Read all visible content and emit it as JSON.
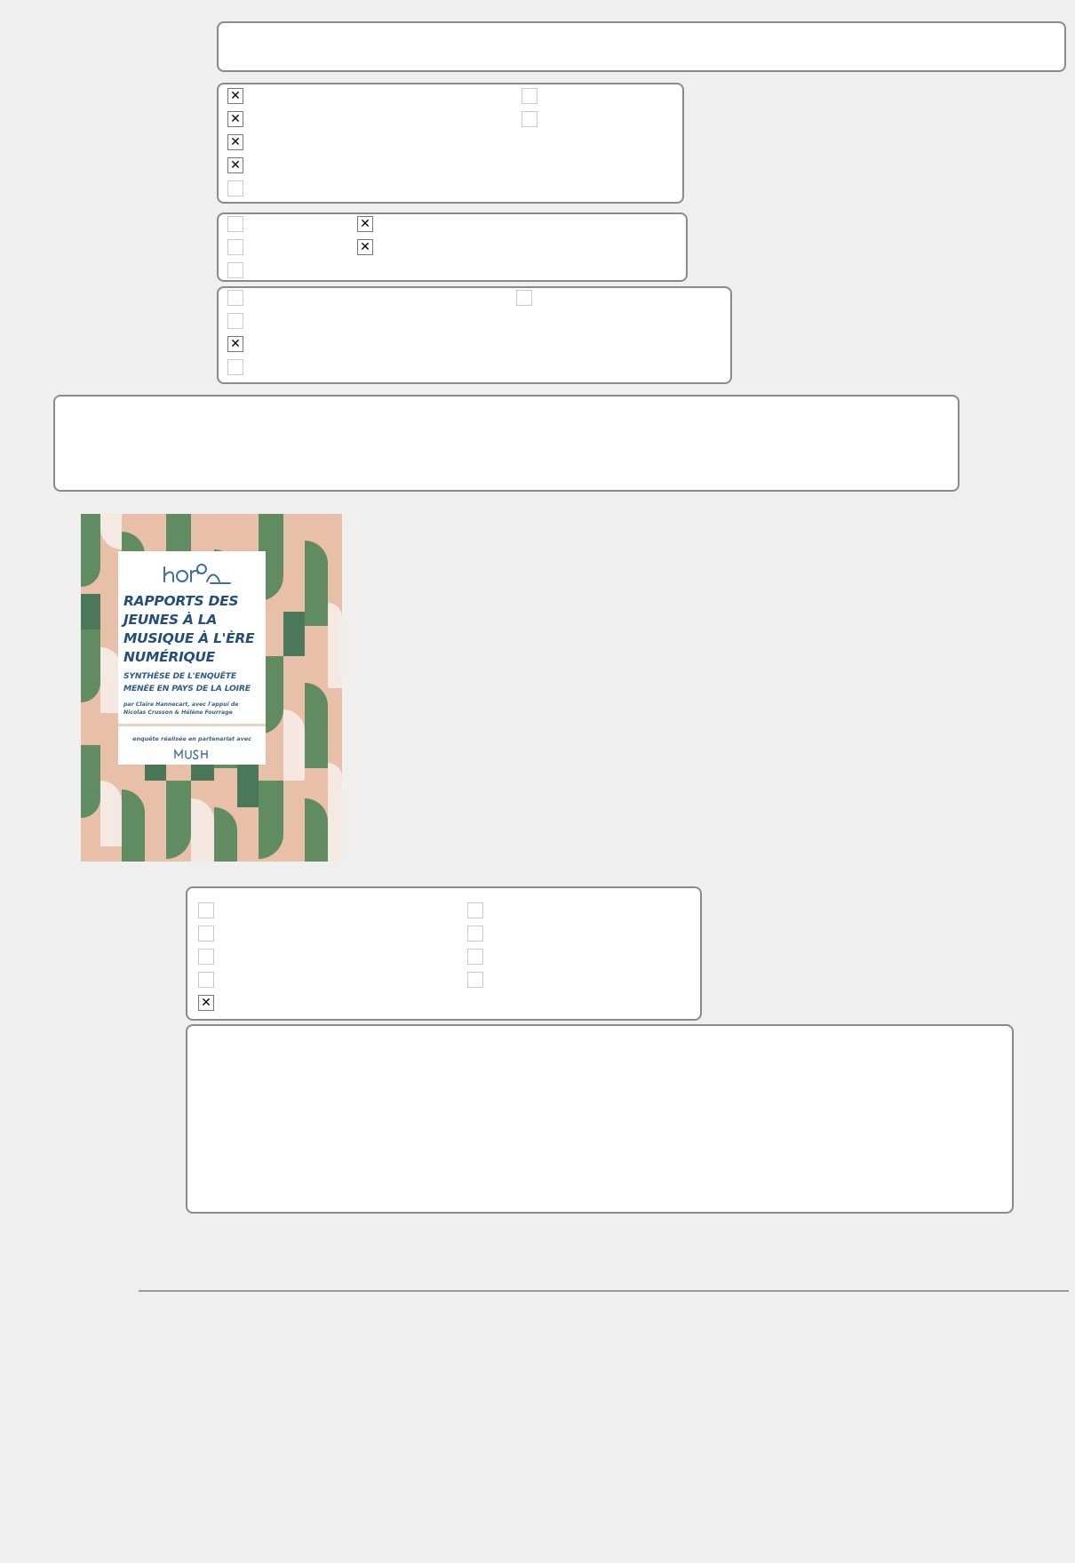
{
  "form": {
    "top_input": {
      "value": ""
    },
    "group_1": {
      "checkboxes": [
        {
          "checked": true
        },
        {
          "checked": true
        },
        {
          "checked": true
        },
        {
          "checked": true
        },
        {
          "checked": false
        },
        {
          "checked": false
        },
        {
          "checked": false
        }
      ]
    },
    "group_2": {
      "checkboxes": [
        {
          "checked": false
        },
        {
          "checked": false
        },
        {
          "checked": false
        },
        {
          "checked": true
        },
        {
          "checked": true
        }
      ]
    },
    "group_3": {
      "checkboxes": [
        {
          "checked": false
        },
        {
          "checked": false
        },
        {
          "checked": true
        },
        {
          "checked": false
        },
        {
          "checked": false
        }
      ]
    },
    "text_area_1": {
      "value": ""
    },
    "group_4": {
      "checkboxes": [
        {
          "checked": false
        },
        {
          "checked": false
        },
        {
          "checked": false
        },
        {
          "checked": false
        },
        {
          "checked": true
        },
        {
          "checked": false
        },
        {
          "checked": false
        },
        {
          "checked": false
        },
        {
          "checked": false
        }
      ]
    },
    "text_area_2": {
      "value": ""
    }
  },
  "cover": {
    "title": "RAPPORTS DES\nJEUNES À LA\nMUSIQUE À L'ÈRE\nNUMÉRIQUE",
    "subtitle": "SYNTHÈSE DE L'ENQUÊTE\nMENÉE EN PAYS DE LA LOIRE",
    "authors": "par Claire Hannecart, avec l'appui de\nNicolas Crusson & Hélène Fourrage",
    "partner": "enquête réalisée en partenariat avec",
    "colors": {
      "green": "#5a8a5e",
      "dark_green": "#2f6b4a",
      "peach": "#e8bfa8",
      "pale": "#f6ebe6",
      "title_blue": "#244f7a"
    }
  }
}
